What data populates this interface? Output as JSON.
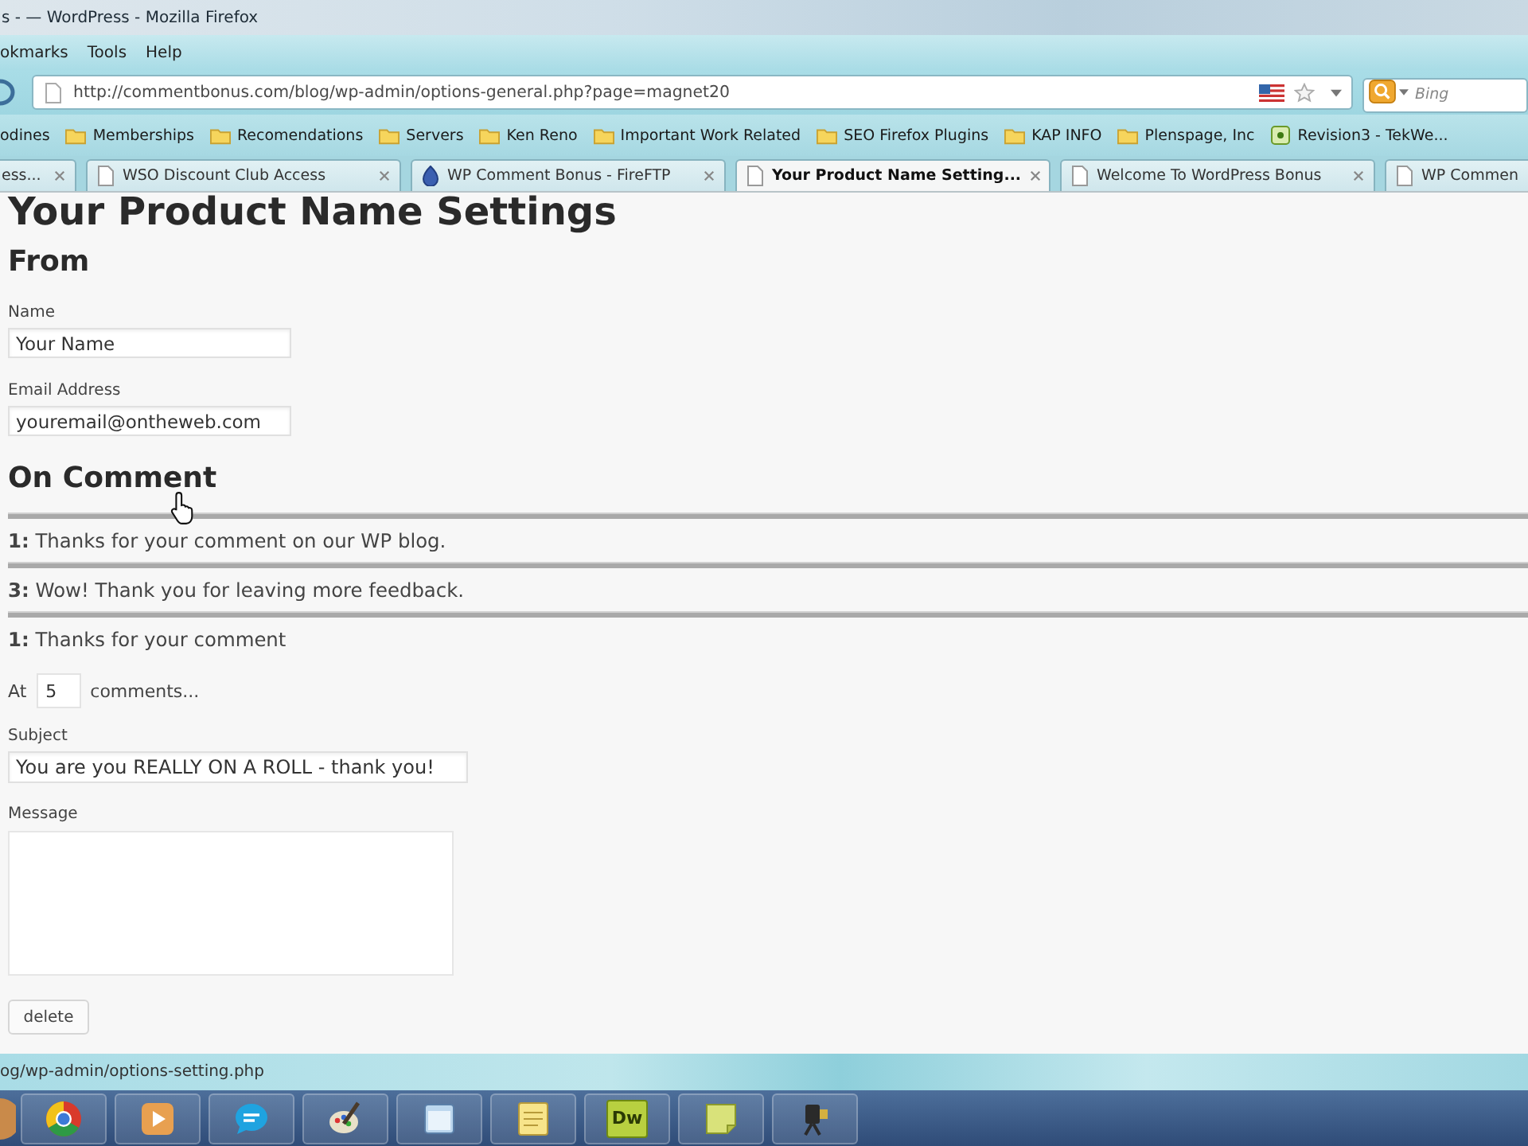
{
  "window": {
    "title": "s - — WordPress - Mozilla Firefox"
  },
  "menu_bar": [
    {
      "label": "okmarks"
    },
    {
      "label": "Tools"
    },
    {
      "label": "Help"
    }
  ],
  "navigation": {
    "url": "http://commentbonus.com/blog/wp-admin/options-general.php?page=magnet20",
    "search": {
      "placeholder": "Bing"
    }
  },
  "bookmarks_bar": [
    {
      "label": "odines",
      "kind": "plain"
    },
    {
      "label": "Memberships",
      "kind": "folder"
    },
    {
      "label": "Recomendations",
      "kind": "folder"
    },
    {
      "label": "Servers",
      "kind": "folder"
    },
    {
      "label": "Ken Reno",
      "kind": "folder"
    },
    {
      "label": "Important Work Related",
      "kind": "folder"
    },
    {
      "label": "SEO Firefox Plugins",
      "kind": "folder"
    },
    {
      "label": "KAP INFO",
      "kind": "folder"
    },
    {
      "label": "Plenspage, Inc",
      "kind": "folder"
    },
    {
      "label": "Revision3 - TekWe...",
      "kind": "site"
    }
  ],
  "tabs": [
    {
      "label": "ess...",
      "kind": "none",
      "selected": false
    },
    {
      "label": "WSO Discount Club Access",
      "kind": "page",
      "selected": false
    },
    {
      "label": "WP Comment Bonus - FireFTP",
      "kind": "extension",
      "selected": false
    },
    {
      "label": "Your Product Name Setting...",
      "kind": "page",
      "selected": true
    },
    {
      "label": "Welcome To WordPress Bonus",
      "kind": "page",
      "selected": false
    },
    {
      "label": "WP Commen",
      "kind": "page",
      "selected": false
    }
  ],
  "page": {
    "title": "Your Product Name Settings",
    "from": {
      "heading": "From",
      "fields": [
        {
          "label": "Name",
          "value": "Your Name"
        },
        {
          "label": "Email Address",
          "value": "youremail@ontheweb.com"
        }
      ]
    },
    "on_comment": {
      "heading": "On Comment",
      "rules": [
        {
          "text": "**1:** Thanks for your comment on our WP blog."
        },
        {
          "text": "**3:** Wow! Thank you for leaving more feedback."
        },
        {
          "text": "**1:** Thanks for your comment"
        }
      ],
      "trigger": {
        "prefix": "At",
        "value": "5",
        "suffix": "comments..."
      },
      "subject": {
        "label": "Subject",
        "value": "You are you REALLY ON A ROLL - thank you!"
      },
      "message": {
        "label": "Message"
      },
      "delete_button": "delete"
    }
  },
  "status_bar": {
    "text": "og/wp-admin/options-setting.php"
  },
  "taskbar": {
    "items": [
      {
        "kind": "browser"
      },
      {
        "kind": "media"
      },
      {
        "kind": "chat"
      },
      {
        "kind": "paint"
      },
      {
        "kind": "window"
      },
      {
        "kind": "notes"
      },
      {
        "kind": "tile",
        "label": "Dw"
      },
      {
        "kind": "sticky"
      },
      {
        "kind": "camera"
      }
    ]
  }
}
